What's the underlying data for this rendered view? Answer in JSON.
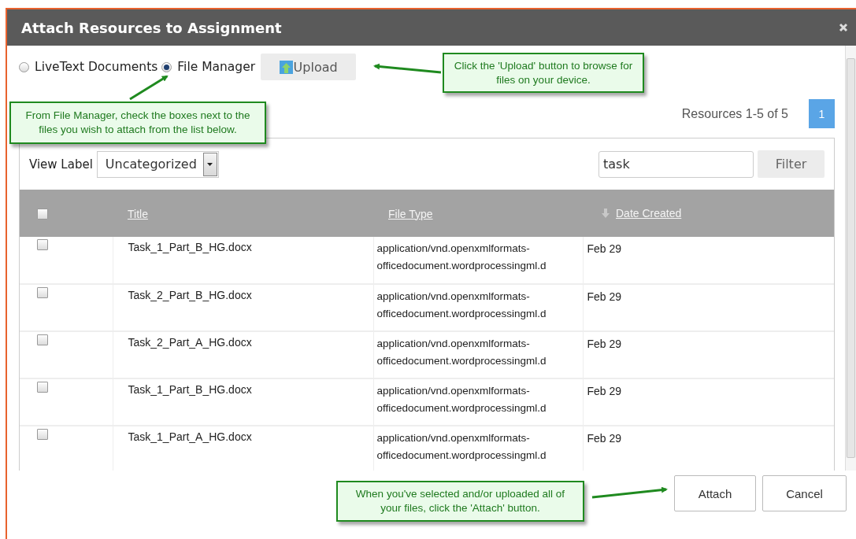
{
  "window": {
    "title": "Attach Resources to Assignment"
  },
  "sources": [
    {
      "label": "LiveText Documents",
      "selected": false
    },
    {
      "label": "File Manager",
      "selected": true
    }
  ],
  "upload_button": {
    "label": "Upload"
  },
  "pager": {
    "summary": "Resources 1-5 of 5",
    "pages": [
      {
        "label": "1",
        "selected": true
      }
    ]
  },
  "filter": {
    "view_label": "View Label",
    "category": "Uncategorized",
    "search": "task",
    "button": "Filter"
  },
  "table": {
    "select_all": {
      "checked": false
    },
    "columns": [
      {
        "label": "Title",
        "sorted": false
      },
      {
        "label": "File Type",
        "sorted": false
      },
      {
        "label": "Date Created",
        "sorted": true
      }
    ],
    "rows": [
      {
        "checked": false,
        "title": "Task_1_Part_B_HG.docx",
        "file_type": "application/vnd.openxmlformats-officedocument.wordprocessingml.d",
        "date": "Feb 29"
      },
      {
        "checked": false,
        "title": "Task_2_Part_B_HG.docx",
        "file_type": "application/vnd.openxmlformats-officedocument.wordprocessingml.d",
        "date": "Feb 29"
      },
      {
        "checked": false,
        "title": "Task_2_Part_A_HG.docx",
        "file_type": "application/vnd.openxmlformats-officedocument.wordprocessingml.d",
        "date": "Feb 29"
      },
      {
        "checked": false,
        "title": "Task_1_Part_B_HG.docx",
        "file_type": "application/vnd.openxmlformats-officedocument.wordprocessingml.d",
        "date": "Feb 29"
      },
      {
        "checked": false,
        "title": "Task_1_Part_A_HG.docx",
        "file_type": "application/vnd.openxmlformats-officedocument.wordprocessingml.d",
        "date": "Feb 29"
      }
    ]
  },
  "buttons": [
    "Attach",
    "Cancel"
  ],
  "callouts": [
    {
      "text": "From File Manager, check the boxes next to the files you wish to attach from the list below."
    },
    {
      "text": "Click the 'Upload' button to browse for files on your device."
    },
    {
      "text": "When you've selected and/or uploaded all of your files, click the 'Attach' button."
    }
  ]
}
